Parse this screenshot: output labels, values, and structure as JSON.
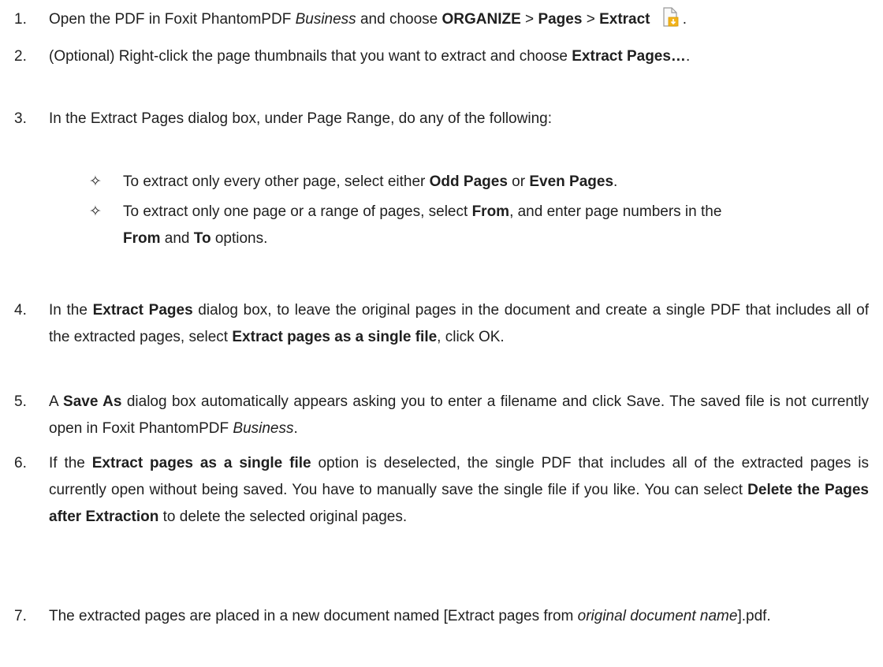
{
  "steps": [
    {
      "num": "1.",
      "parts": [
        {
          "t": "Open the PDF in Foxit PhantomPDF "
        },
        {
          "t": "Business",
          "i": true
        },
        {
          "t": " and choose "
        },
        {
          "t": "ORGANIZE",
          "b": true
        },
        {
          "t": " > "
        },
        {
          "t": "Pages",
          "b": true
        },
        {
          "t": " > "
        },
        {
          "t": "Extract",
          "b": true
        }
      ],
      "icon": "extract-pages-icon",
      "suffix": " ."
    },
    {
      "num": "2.",
      "parts": [
        {
          "t": "(Optional) Right-click the page thumbnails that you want to extract and choose "
        },
        {
          "t": "Extract Pages…",
          "b": true
        },
        {
          "t": "."
        }
      ]
    },
    {
      "num": "3.",
      "parts": [
        {
          "t": "In the Extract Pages dialog box, under Page Range, do any of the following:"
        }
      ]
    },
    {
      "num": "4.",
      "parts": [
        {
          "t": "In the "
        },
        {
          "t": "Extract Pages",
          "b": true
        },
        {
          "t": " dialog box, to leave the original pages in the document and create a single PDF that includes all of the extracted pages, select "
        },
        {
          "t": "Extract pages as a single file",
          "b": true
        },
        {
          "t": ", click OK."
        }
      ]
    },
    {
      "num": "5.",
      "parts": [
        {
          "t": "A "
        },
        {
          "t": "Save As",
          "b": true
        },
        {
          "t": " dialog box automatically appears asking you to enter a filename and click Save. The saved file is not currently open in Foxit PhantomPDF "
        },
        {
          "t": "Business",
          "i": true
        },
        {
          "t": "."
        }
      ]
    },
    {
      "num": "6.",
      "parts": [
        {
          "t": "If the "
        },
        {
          "t": "Extract pages as a single file",
          "b": true
        },
        {
          "t": " option is deselected, the single PDF that includes all of the extracted pages is currently open without being saved. You have to manually save the single file if you like. You can select "
        },
        {
          "t": "Delete the Pages after Extraction",
          "b": true
        },
        {
          "t": " to delete the selected original pages."
        }
      ]
    },
    {
      "num": "7.",
      "parts": [
        {
          "t": "The extracted pages are placed in a new document named [Extract pages from "
        },
        {
          "t": "original document name",
          "i": true
        },
        {
          "t": "].pdf."
        }
      ]
    }
  ],
  "bullets": [
    {
      "parts": [
        {
          "t": "To extract only every other page, select either "
        },
        {
          "t": "Odd Pages",
          "b": true
        },
        {
          "t": " or "
        },
        {
          "t": "Even Pages",
          "b": true
        },
        {
          "t": "."
        }
      ]
    },
    {
      "parts": [
        {
          "t": "To extract only one page or a range of pages, select "
        },
        {
          "t": "From",
          "b": true
        },
        {
          "t": ", and enter page numbers in the "
        },
        {
          "t": "From",
          "b": true
        },
        {
          "t": " and "
        },
        {
          "t": "To",
          "b": true
        },
        {
          "t": " options."
        }
      ]
    }
  ],
  "bullet_glyph": "✧"
}
